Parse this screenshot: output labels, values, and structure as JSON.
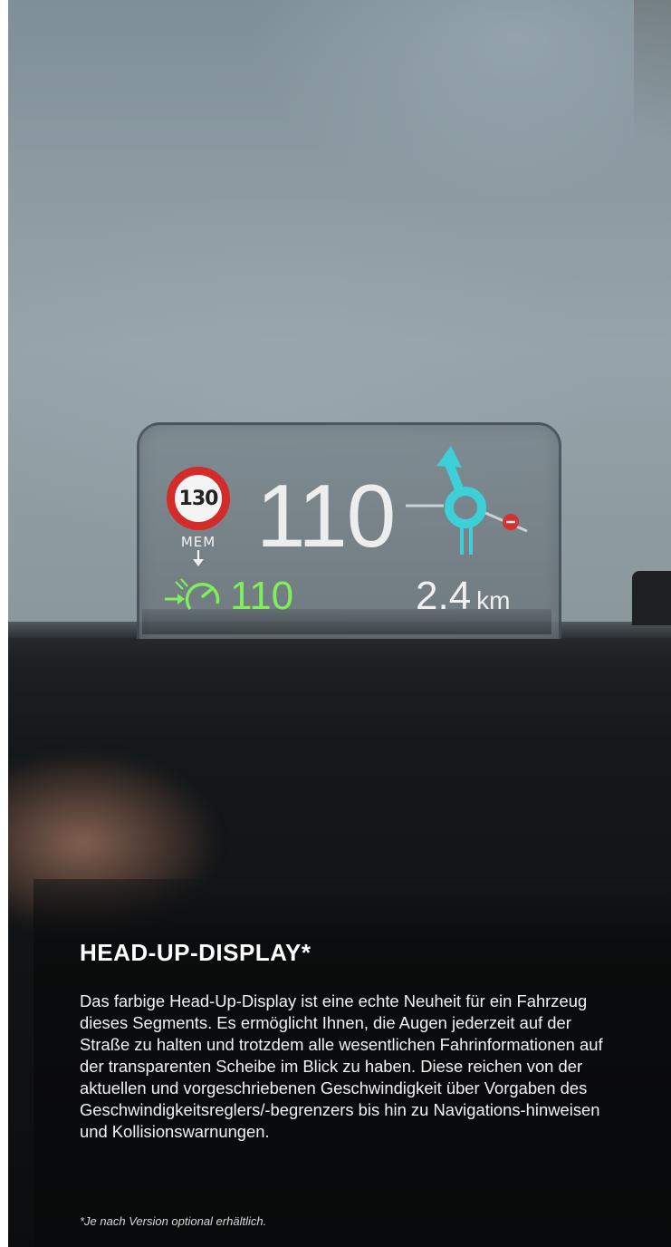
{
  "hud": {
    "speed_limit": "130",
    "memory_label": "MEM",
    "current_speed": "110",
    "cruise_speed": "110",
    "distance_value": "2.4",
    "distance_unit": "km",
    "colors": {
      "speed_sign_ring": "#d32a2a",
      "cruise": "#7ff05a",
      "navigation": "#3ed0d8",
      "nav_marker": "#d63030"
    },
    "icons": [
      "speed-limit-sign-icon",
      "memory-arrow-icon",
      "cruise-control-icon",
      "roundabout-navigation-icon"
    ]
  },
  "article": {
    "title": "HEAD-UP-DISPLAY*",
    "body": "Das farbige Head-Up-Display ist eine echte Neuheit für ein Fahrzeug dieses Segments. Es ermöglicht Ihnen, die Augen jederzeit auf der Straße zu halten und trotzdem alle wesentlichen Fahrinformationen auf der transparenten Scheibe im Blick zu haben. Diese reichen von der aktuellen und vorgeschriebenen Geschwindigkeit über Vorgaben des Geschwindigkeitsreglers/-begrenzers bis hin zu Navigations-hinweisen und Kollisionswarnungen.",
    "footnote": "*Je nach Version optional erhältlich."
  }
}
